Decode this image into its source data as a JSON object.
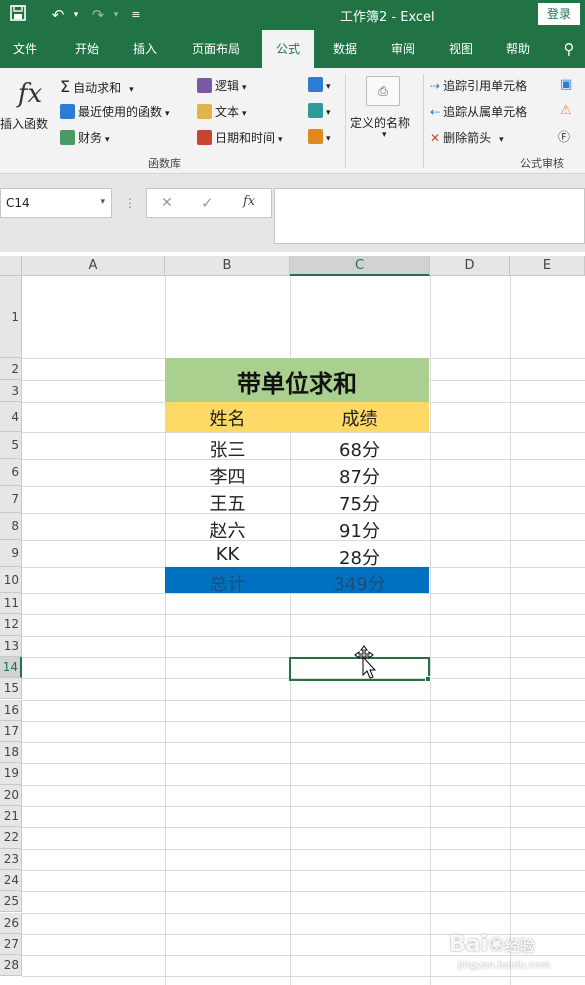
{
  "titlebar": {
    "title": "工作簿2  -  Excel",
    "login": "登录",
    "colors": {
      "brand": "#217346"
    }
  },
  "tabs": [
    "文件",
    "开始",
    "插入",
    "页面布局",
    "公式",
    "数据",
    "审阅",
    "视图",
    "帮助"
  ],
  "active_tab": "公式",
  "ribbon": {
    "insert_function": "插入函数",
    "autosum": "自动求和",
    "recent": "最近使用的函数",
    "financial": "财务",
    "logical": "逻辑",
    "text": "文本",
    "datetime": "日期和时间",
    "group_library": "函数库",
    "defined_names": "定义的名称",
    "trace_precedents": "追踪引用单元格",
    "trace_dependents": "追踪从属单元格",
    "remove_arrows": "删除箭头",
    "group_audit": "公式审核"
  },
  "formula_bar": {
    "name_box": "C14",
    "fx": "fx",
    "value": ""
  },
  "columns": [
    "A",
    "B",
    "C",
    "D",
    "E"
  ],
  "selected_column": "C",
  "rows": [
    "1",
    "2",
    "3",
    "4",
    "5",
    "6",
    "7",
    "8",
    "9",
    "10",
    "11",
    "12",
    "13",
    "14",
    "15",
    "16",
    "17",
    "18",
    "19",
    "20",
    "21",
    "22",
    "23",
    "24",
    "25",
    "26",
    "27",
    "28"
  ],
  "selected_row": "14",
  "table": {
    "title": "带单位求和",
    "headers": [
      "姓名",
      "成绩"
    ],
    "records": [
      {
        "name": "张三",
        "score": "68分"
      },
      {
        "name": "李四",
        "score": "87分"
      },
      {
        "name": "王五",
        "score": "75分"
      },
      {
        "name": "赵六",
        "score": "91分"
      },
      {
        "name": "KK",
        "score": "28分"
      }
    ],
    "total": {
      "label": "总计",
      "value": "349分"
    },
    "colors": {
      "title_bg": "#a9d08e",
      "header_bg": "#ffd966",
      "total_bg": "#0070c0",
      "total_text": "#1f4e79"
    }
  },
  "watermark": {
    "brand": "Bai",
    "brand2": "经验",
    "url": "jingyan.baidu.com"
  }
}
